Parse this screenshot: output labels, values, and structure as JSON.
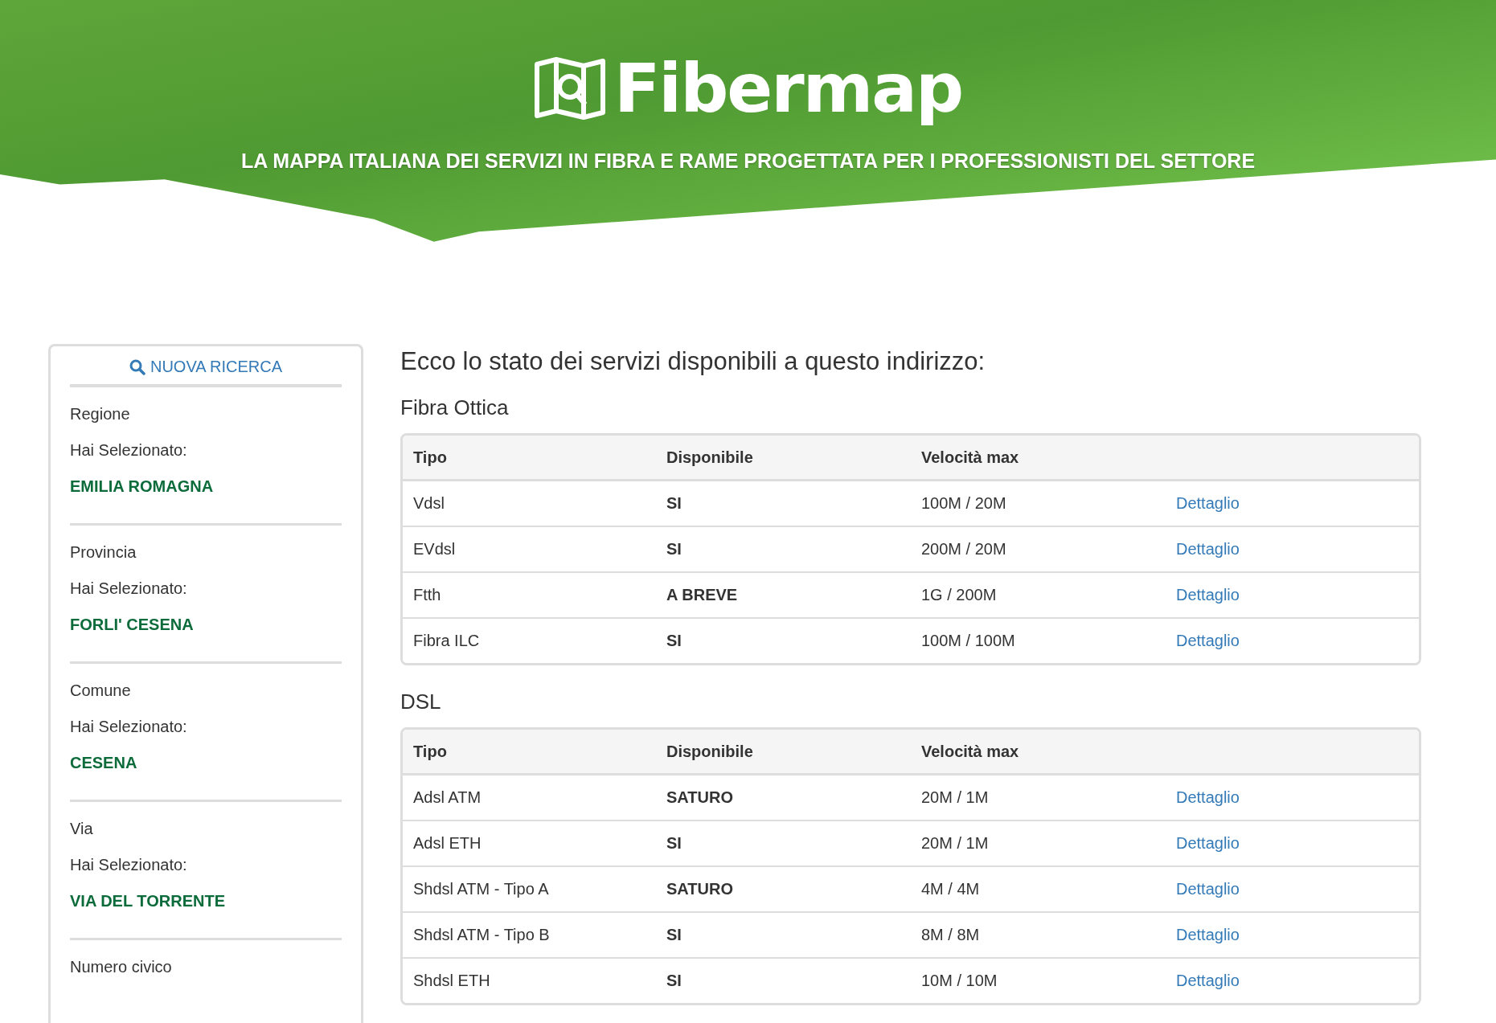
{
  "header": {
    "logo_text": "Fibermap",
    "tagline": "LA MAPPA ITALIANA DEI SERVIZI IN FIBRA E RAME PROGETTATA PER I PROFESSIONISTI DEL SETTORE"
  },
  "sidebar": {
    "search_button": "NUOVA RICERCA",
    "sections": [
      {
        "label": "Regione",
        "hint": "Hai Selezionato:",
        "value": "EMILIA ROMAGNA"
      },
      {
        "label": "Provincia",
        "hint": "Hai Selezionato:",
        "value": "FORLI' CESENA"
      },
      {
        "label": "Comune",
        "hint": "Hai Selezionato:",
        "value": "CESENA"
      },
      {
        "label": "Via",
        "hint": "Hai Selezionato:",
        "value": "VIA DEL TORRENTE"
      },
      {
        "label": "Numero civico"
      }
    ]
  },
  "main": {
    "heading": "Ecco lo stato dei servizi disponibili a questo indirizzo:",
    "tables": [
      {
        "title": "Fibra Ottica",
        "columns": [
          "Tipo",
          "Disponibile",
          "Velocità max"
        ],
        "rows": [
          {
            "tipo": "Vdsl",
            "disponibile": "SI",
            "velocita": "100M / 20M",
            "link": "Dettaglio"
          },
          {
            "tipo": "EVdsl",
            "disponibile": "SI",
            "velocita": "200M / 20M",
            "link": "Dettaglio"
          },
          {
            "tipo": "Ftth",
            "disponibile": "A BREVE",
            "velocita": "1G / 200M",
            "link": "Dettaglio"
          },
          {
            "tipo": "Fibra ILC",
            "disponibile": "SI",
            "velocita": "100M / 100M",
            "link": "Dettaglio"
          }
        ]
      },
      {
        "title": "DSL",
        "columns": [
          "Tipo",
          "Disponibile",
          "Velocità max"
        ],
        "rows": [
          {
            "tipo": "Adsl ATM",
            "disponibile": "SATURO",
            "velocita": "20M / 1M",
            "link": "Dettaglio"
          },
          {
            "tipo": "Adsl ETH",
            "disponibile": "SI",
            "velocita": "20M / 1M",
            "link": "Dettaglio"
          },
          {
            "tipo": "Shdsl ATM - Tipo A",
            "disponibile": "SATURO",
            "velocita": "4M / 4M",
            "link": "Dettaglio"
          },
          {
            "tipo": "Shdsl ATM - Tipo B",
            "disponibile": "SI",
            "velocita": "8M / 8M",
            "link": "Dettaglio"
          },
          {
            "tipo": "Shdsl ETH",
            "disponibile": "SI",
            "velocita": "10M / 10M",
            "link": "Dettaglio"
          }
        ]
      }
    ]
  }
}
